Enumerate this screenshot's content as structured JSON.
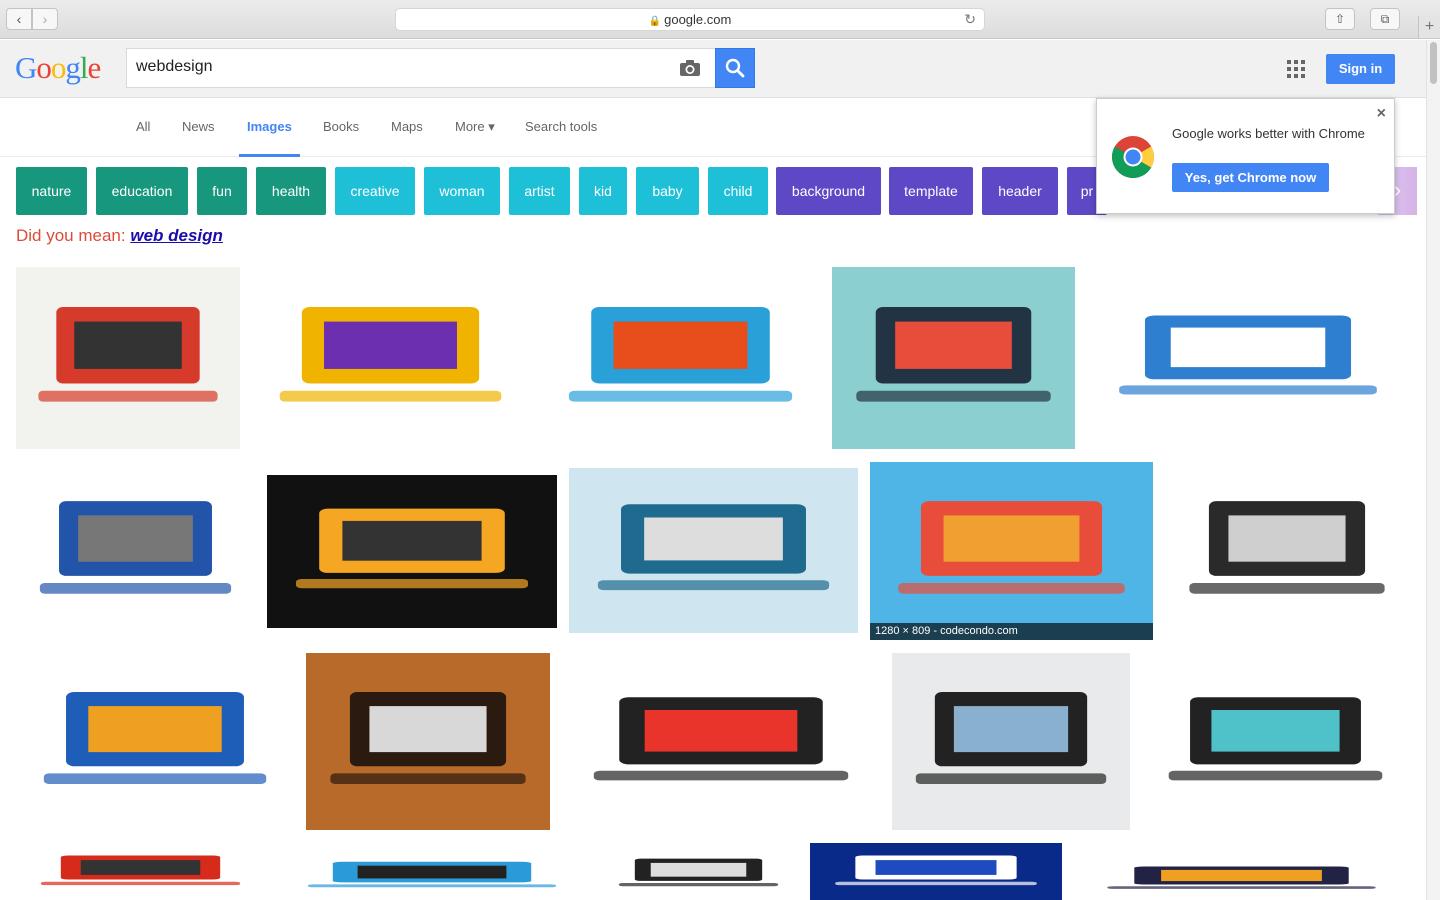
{
  "browser": {
    "back": "‹",
    "forward": "›",
    "url": "google.com",
    "reload": "↻",
    "share": "⇧",
    "tabs": "⧉",
    "new_tab": "+"
  },
  "logo": [
    "G",
    "o",
    "o",
    "g",
    "l",
    "e"
  ],
  "logo_colors": [
    "#4285f4",
    "#ea4335",
    "#fbbc05",
    "#4285f4",
    "#34a853",
    "#ea4335"
  ],
  "search": {
    "value": "webdesign"
  },
  "signin_label": "Sign in",
  "tabs": [
    {
      "label": "All"
    },
    {
      "label": "News"
    },
    {
      "label": "Images"
    },
    {
      "label": "Books"
    },
    {
      "label": "Maps"
    },
    {
      "label": "More ▾"
    },
    {
      "label": "Search tools"
    }
  ],
  "chips": [
    {
      "label": "nature",
      "color": "#17977e"
    },
    {
      "label": "education",
      "color": "#17977e"
    },
    {
      "label": "fun",
      "color": "#17977e"
    },
    {
      "label": "health",
      "color": "#17977e"
    },
    {
      "label": "creative",
      "color": "#1ec0d8"
    },
    {
      "label": "woman",
      "color": "#1ec0d8"
    },
    {
      "label": "artist",
      "color": "#1ec0d8"
    },
    {
      "label": "kid",
      "color": "#1ec0d8"
    },
    {
      "label": "baby",
      "color": "#1ec0d8"
    },
    {
      "label": "child",
      "color": "#1ec0d8"
    },
    {
      "label": "background",
      "color": "#5e48c6"
    },
    {
      "label": "template",
      "color": "#5e48c6"
    },
    {
      "label": "header",
      "color": "#5e48c6"
    },
    {
      "label": "pr",
      "color": "#5e48c6"
    }
  ],
  "did_you_mean": {
    "prefix": "Did you mean: ",
    "suggestion": "web design"
  },
  "promo": {
    "text": "Google works better with Chrome",
    "button": "Yes, get Chrome now",
    "close": "×"
  },
  "image_caption": "1280 × 809 - codecondo.com",
  "images": [
    {
      "name": "web-design-concept-sketch",
      "colors": [
        "#f2f2ee",
        "#d63a2a",
        "#333333"
      ]
    },
    {
      "name": "laptop-paint-splash",
      "colors": [
        "#ffffff",
        "#f0b400",
        "#6b2fb0"
      ]
    },
    {
      "name": "responsive-devices",
      "colors": [
        "#ffffff",
        "#2aa0d8",
        "#e84d1c"
      ]
    },
    {
      "name": "flat-design-icons",
      "colors": [
        "#8ccfd0",
        "#223344",
        "#e84d3c"
      ]
    },
    {
      "name": "web-design-blue-cubes",
      "colors": [
        "#ffffff",
        "#2e7fd0",
        "#ffffff"
      ]
    },
    {
      "name": "man-touching-screens",
      "colors": [
        "#ffffff",
        "#2255aa",
        "#777777"
      ]
    },
    {
      "name": "hand-glowing-images",
      "colors": [
        "#111111",
        "#f5a623",
        "#333333"
      ]
    },
    {
      "name": "finger-on-keyboard",
      "colors": [
        "#cfe6f0",
        "#1f6b8f",
        "#dddddd"
      ]
    },
    {
      "name": "website-construction-flat",
      "colors": [
        "#4fb4e6",
        "#e84d3c",
        "#f0a030"
      ]
    },
    {
      "name": "devices-gray-screens",
      "colors": [
        "#ffffff",
        "#2a2a2a",
        "#cfcfcf"
      ]
    },
    {
      "name": "web-design-3d-text",
      "colors": [
        "#ffffff",
        "#1e5db8",
        "#f0a020"
      ]
    },
    {
      "name": "laptop-on-wood-table",
      "colors": [
        "#b86a2a",
        "#2a1a10",
        "#d8d8d8"
      ]
    },
    {
      "name": "http-www-rainbow",
      "colors": [
        "#ffffff",
        "#222222",
        "#e8342a"
      ]
    },
    {
      "name": "devices-white-website",
      "colors": [
        "#e8eaec",
        "#222222",
        "#8ab0d0"
      ]
    },
    {
      "name": "devices-teal-website",
      "colors": [
        "#ffffff",
        "#222222",
        "#4ec2c8"
      ]
    },
    {
      "name": "web-red-text",
      "colors": [
        "#ffffff",
        "#d62a1a",
        "#333333"
      ]
    },
    {
      "name": "responsive-web-design-monitor",
      "colors": [
        "#ffffff",
        "#2a9ad8",
        "#222222"
      ]
    },
    {
      "name": "monitor-outline",
      "colors": [
        "#ffffff",
        "#222222",
        "#dddddd"
      ]
    },
    {
      "name": "word-cloud-blue",
      "colors": [
        "#0a2a8a",
        "#ffffff",
        "#1e4cc0"
      ]
    },
    {
      "name": "flat-desk-icons",
      "colors": [
        "#ffffff",
        "#222244",
        "#f0a020"
      ]
    }
  ]
}
